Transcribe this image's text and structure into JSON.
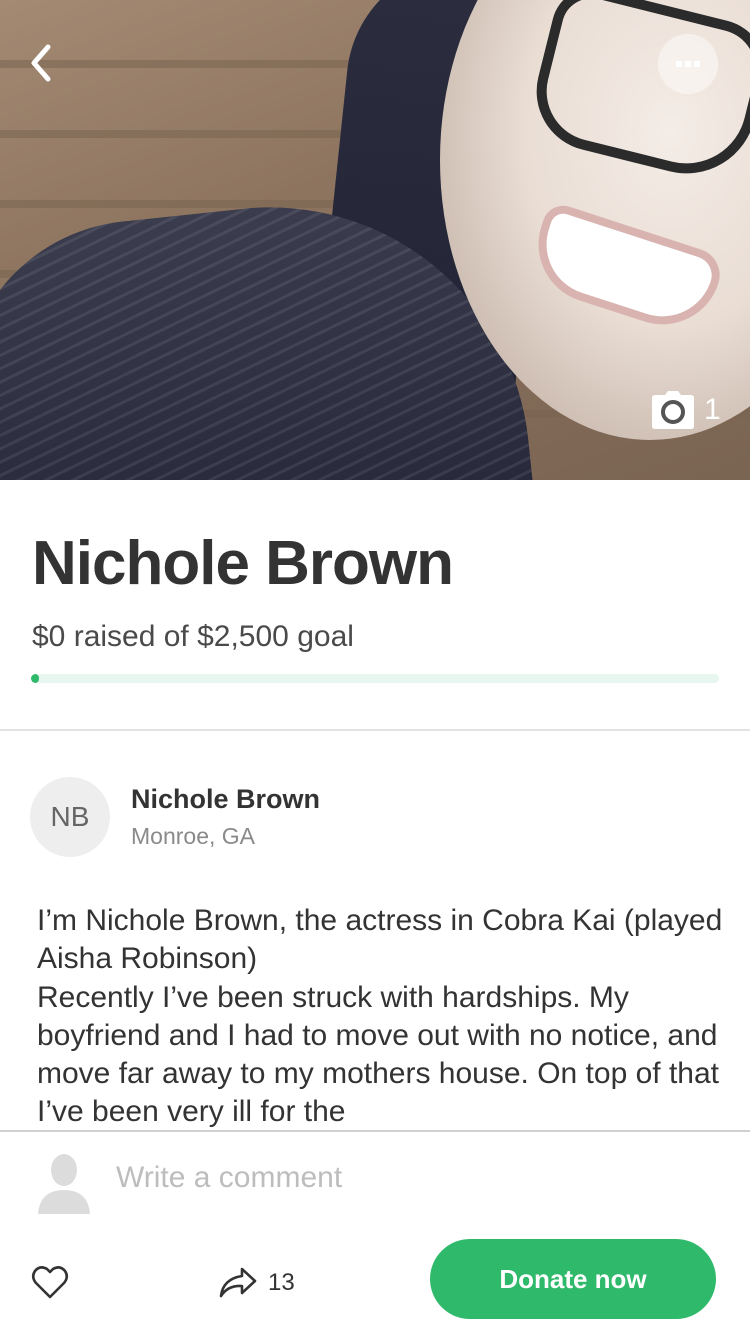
{
  "hero": {
    "photo_count": "1",
    "icons": {
      "back": "chevron-left-icon",
      "more": "more-dots-icon",
      "photo": "camera-icon"
    }
  },
  "campaign": {
    "title": "Nichole Brown",
    "raised_text": "$0 raised of $2,500 goal",
    "raised_amount": 0,
    "goal_amount": 2500,
    "progress_fraction": 0
  },
  "organizer": {
    "initials": "NB",
    "name": "Nichole Brown",
    "location": "Monroe, GA"
  },
  "story": {
    "paragraphs": [
      "I’m Nichole Brown, the actress in Cobra Kai (played Aisha Robinson)",
      "Recently I’ve been struck with hardships. My boyfriend and I had to move out with no notice, and move far away to my mothers house. On top of that I’ve been very ill for the"
    ]
  },
  "comment": {
    "placeholder": "Write a comment"
  },
  "footer": {
    "share_count": "13",
    "donate_label": "Donate now"
  },
  "colors": {
    "accent": "#2fb96b",
    "progress_track": "#e7f6ee",
    "title_text": "#333333"
  }
}
